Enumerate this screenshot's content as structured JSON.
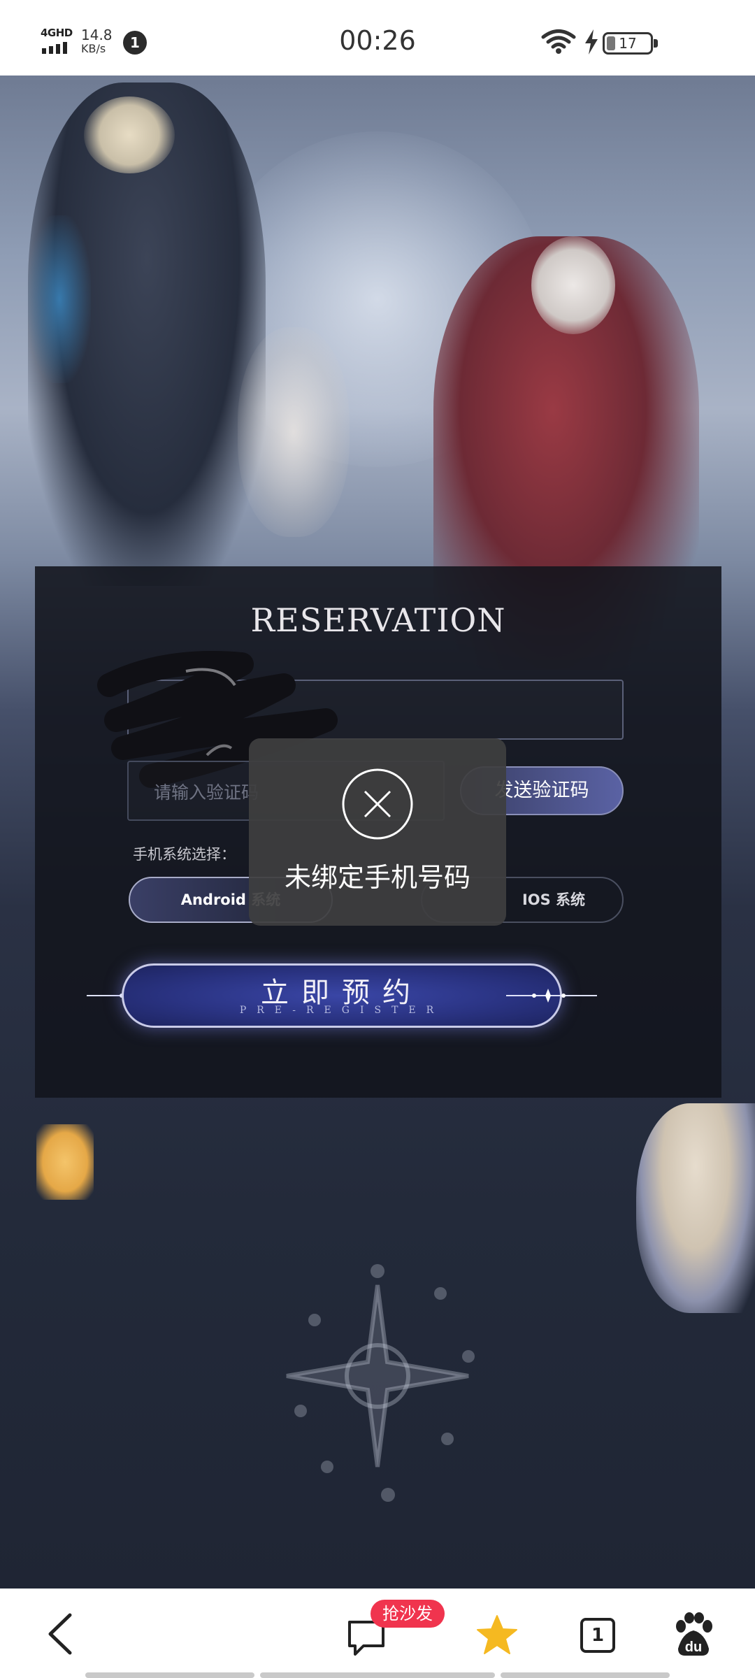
{
  "status_bar": {
    "network": "4GHD",
    "speed_value": "14.8",
    "speed_unit": "KB/s",
    "notification_count": "1",
    "time": "00:26",
    "battery_level": "17"
  },
  "panel": {
    "title": "RESERVATION",
    "code_placeholder": "请输入验证码",
    "send_code_label": "发送验证码",
    "os_label": "手机系统选择：",
    "android_label": "Android 系统",
    "ios_label": "IOS 系统",
    "preregister_main": "立即预约",
    "preregister_sub": "PRE-REGISTER"
  },
  "toast": {
    "message": "未绑定手机号码",
    "icon": "close-circle-icon"
  },
  "bottom_bar": {
    "sofa_badge": "抢沙发",
    "tab_count": "1",
    "icons": [
      "back-icon",
      "comment-icon",
      "star-icon",
      "tabs-icon",
      "baidu-paw-icon"
    ]
  },
  "colors": {
    "accent": "#5a62a4",
    "badge": "#f0344e",
    "star": "#f5b921"
  }
}
